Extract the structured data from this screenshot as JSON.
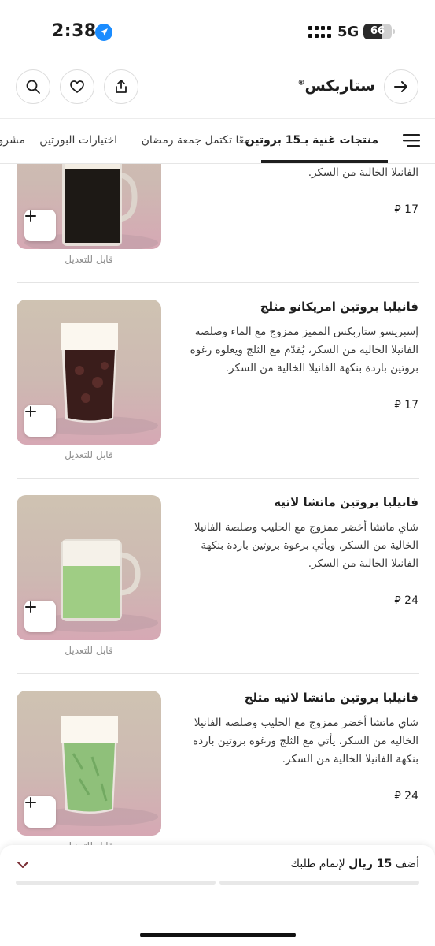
{
  "status_bar": {
    "time": "2:38",
    "network": "5G",
    "battery_level": "66",
    "battery_fraction": 0.66
  },
  "header": {
    "store_name": "ستاربكس",
    "registered_mark": "®",
    "icons": [
      "arrow-right-icon",
      "share-icon",
      "heart-icon",
      "search-icon"
    ]
  },
  "tabs": [
    {
      "label": "منتجات غنية بـ15 بروتين",
      "active": true
    },
    {
      "label": "معًا تكتمل جمعة رمضان",
      "active": false
    },
    {
      "label": "اختيارات البورتين",
      "active": false
    },
    {
      "label": "مشرو",
      "active": false
    }
  ],
  "products": [
    {
      "name": "",
      "description": "الفانيلا الخالية من السكر.",
      "price": "17",
      "customizable": "قابل للتعديل",
      "image": "dark-coffee-mug"
    },
    {
      "name": "فانيليا بروتين امريكانو مثلج",
      "description": "إسبريسو ستاربكس المميز ممزوج مع الماء وصلصة الفانيلا الخالية من السكر، يُقدّم مع الثلج ويعلوه رغوة بروتين باردة بنكهة الفانيلا الخالية من السكر.",
      "price": "17",
      "customizable": "قابل للتعديل",
      "image": "iced-americano-glass"
    },
    {
      "name": "فانيليا بروتين ماتشا لاتيه",
      "description": "شاي ماتشا أخضر ممزوج مع الحليب وصلصة الفانيلا الخالية من السكر، ويأتي برغوة بروتين باردة بنكهة الفانيلا الخالية من السكر.",
      "price": "24",
      "customizable": "قابل للتعديل",
      "image": "matcha-latte-mug"
    },
    {
      "name": "فانيليا بروتين ماتشا لاتيه مثلج",
      "description": "شاي ماتشا أخضر ممزوج مع الحليب وصلصة الفانيلا الخالية من السكر، يأتي مع الثلج ورغوة بروتين باردة بنكهة الفانيلا الخالية من السكر.",
      "price": "24",
      "customizable": "قابل للتعديل",
      "image": "iced-matcha-glass"
    }
  ],
  "currency_symbol": "⃁",
  "promo": {
    "prefix": "أضف",
    "amount": "15 ريال",
    "suffix": "لإتمام طلبك",
    "progress_fraction": 0.0
  },
  "colors": {
    "text": "#1e1e1e",
    "muted": "#8d8d8d",
    "divider": "#e4e4e4"
  }
}
